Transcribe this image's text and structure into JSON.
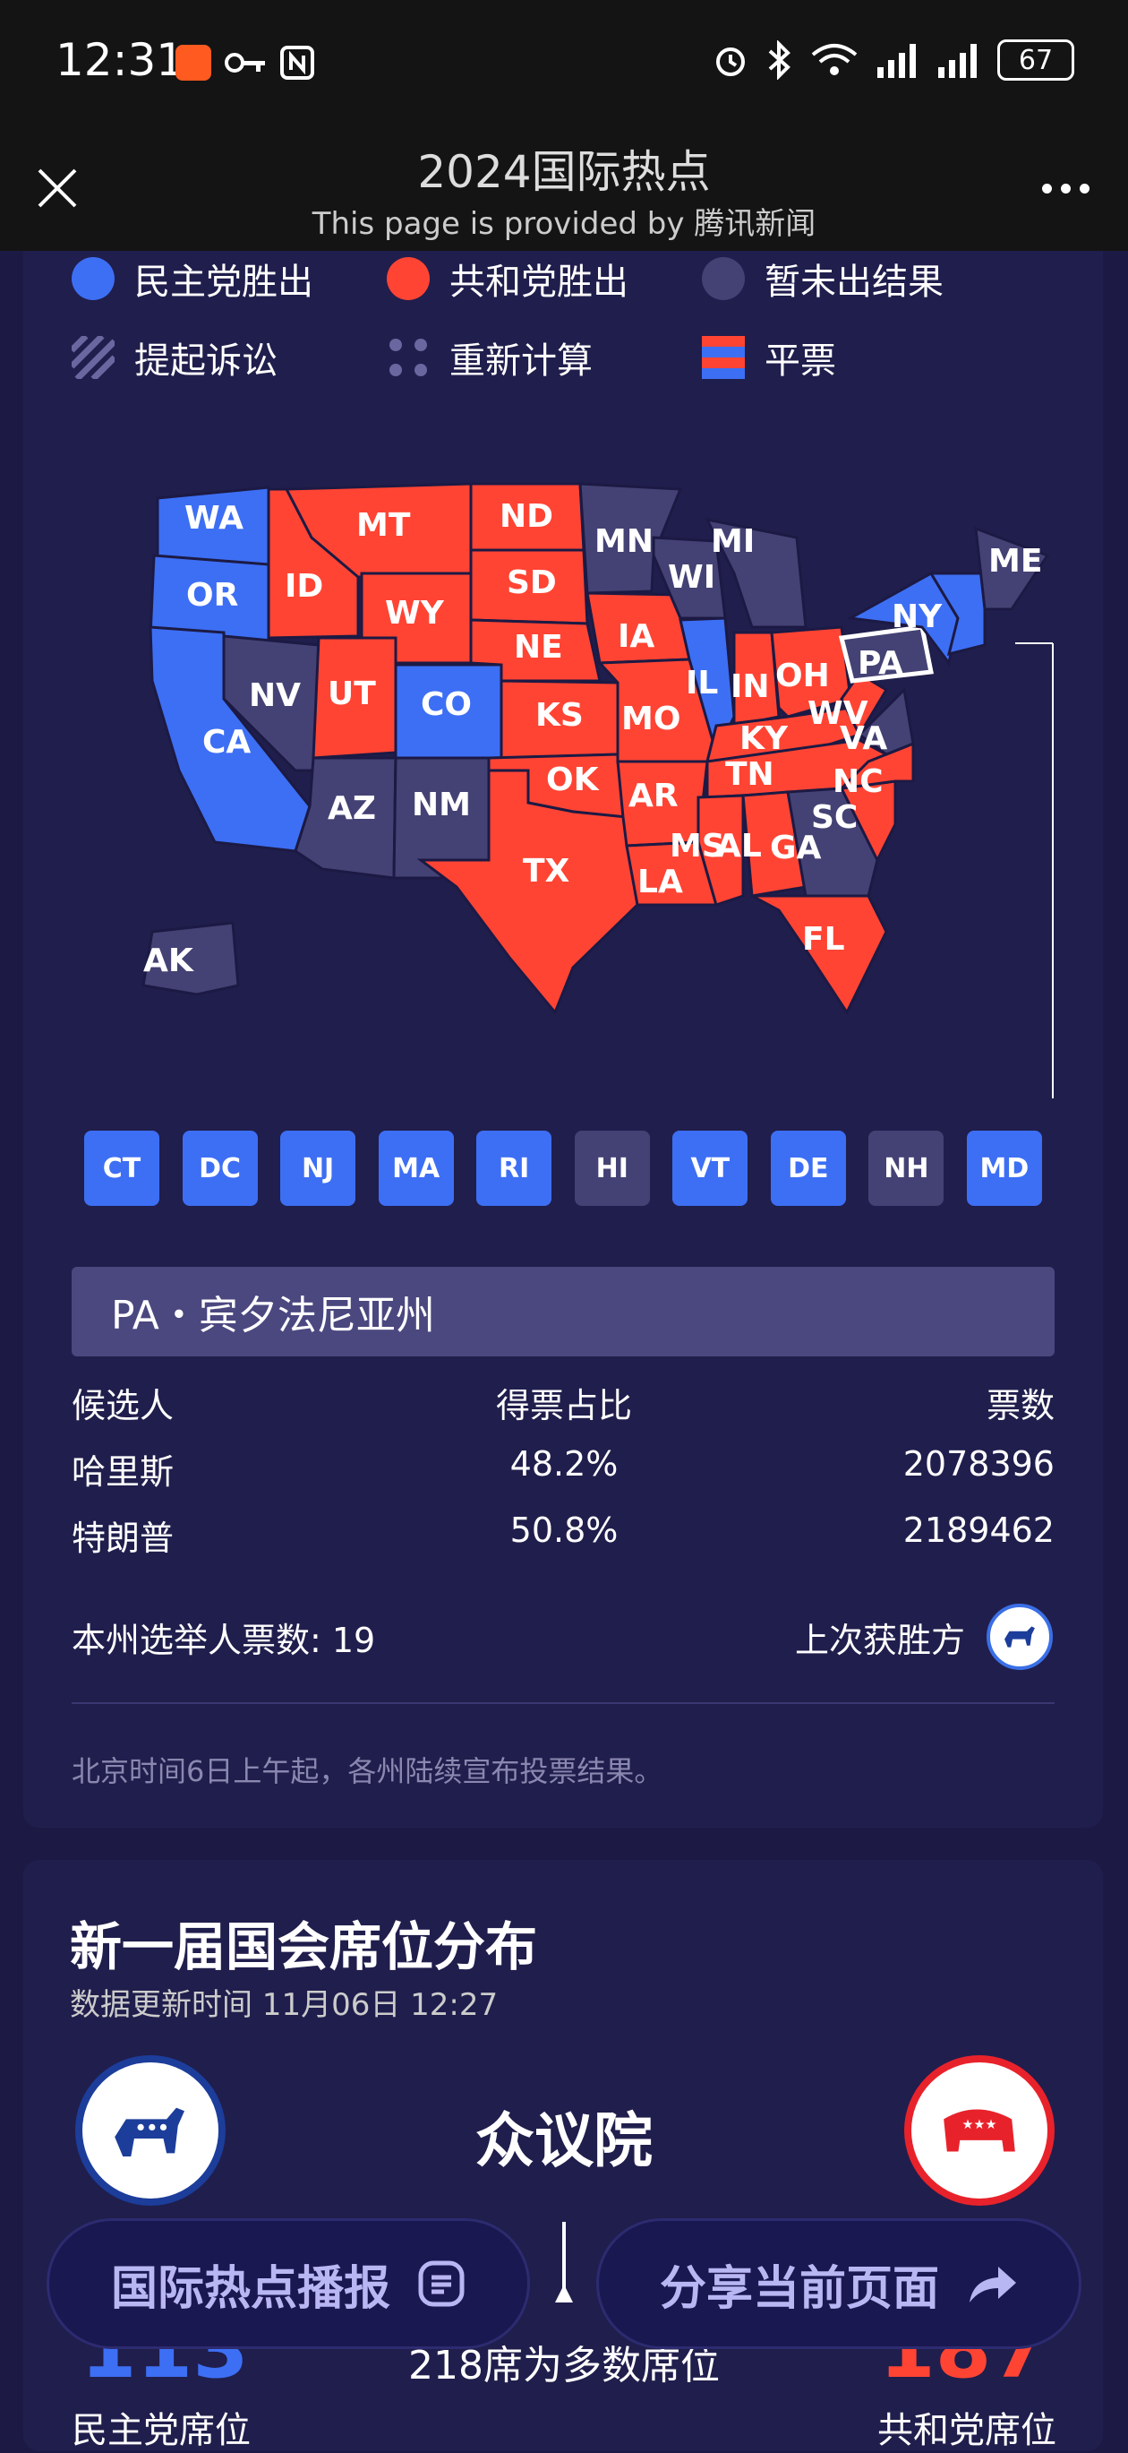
{
  "status_bar": {
    "time": "12:31",
    "battery": "67"
  },
  "title_bar": {
    "title": "2024国际热点",
    "subtitle": "This page is provided by 腾讯新闻"
  },
  "legend": [
    {
      "label": "民主党胜出",
      "color": "#3d6ff4"
    },
    {
      "label": "共和党胜出",
      "color": "#ff4433"
    },
    {
      "label": "暂未出结果",
      "color": "#444274"
    },
    {
      "label": "提起诉讼"
    },
    {
      "label": "重新计算"
    },
    {
      "label": "平票"
    }
  ],
  "map": {
    "states": [
      {
        "abbr": "WA",
        "winner": "dem"
      },
      {
        "abbr": "OR",
        "winner": "dem"
      },
      {
        "abbr": "CA",
        "winner": "dem"
      },
      {
        "abbr": "NV",
        "winner": "pending"
      },
      {
        "abbr": "ID",
        "winner": "rep"
      },
      {
        "abbr": "MT",
        "winner": "rep"
      },
      {
        "abbr": "WY",
        "winner": "rep"
      },
      {
        "abbr": "UT",
        "winner": "rep"
      },
      {
        "abbr": "CO",
        "winner": "dem"
      },
      {
        "abbr": "AZ",
        "winner": "pending"
      },
      {
        "abbr": "NM",
        "winner": "pending"
      },
      {
        "abbr": "ND",
        "winner": "rep"
      },
      {
        "abbr": "SD",
        "winner": "rep"
      },
      {
        "abbr": "NE",
        "winner": "rep"
      },
      {
        "abbr": "KS",
        "winner": "rep"
      },
      {
        "abbr": "OK",
        "winner": "rep"
      },
      {
        "abbr": "TX",
        "winner": "rep"
      },
      {
        "abbr": "MN",
        "winner": "pending"
      },
      {
        "abbr": "IA",
        "winner": "rep"
      },
      {
        "abbr": "MO",
        "winner": "rep"
      },
      {
        "abbr": "AR",
        "winner": "rep"
      },
      {
        "abbr": "LA",
        "winner": "rep"
      },
      {
        "abbr": "WI",
        "winner": "pending"
      },
      {
        "abbr": "IL",
        "winner": "dem"
      },
      {
        "abbr": "MI",
        "winner": "pending"
      },
      {
        "abbr": "IN",
        "winner": "rep"
      },
      {
        "abbr": "OH",
        "winner": "rep"
      },
      {
        "abbr": "KY",
        "winner": "rep"
      },
      {
        "abbr": "TN",
        "winner": "rep"
      },
      {
        "abbr": "MS",
        "winner": "rep"
      },
      {
        "abbr": "AL",
        "winner": "rep"
      },
      {
        "abbr": "GA",
        "winner": "pending"
      },
      {
        "abbr": "FL",
        "winner": "rep"
      },
      {
        "abbr": "SC",
        "winner": "rep"
      },
      {
        "abbr": "NC",
        "winner": "rep"
      },
      {
        "abbr": "VA",
        "winner": "pending"
      },
      {
        "abbr": "WV",
        "winner": "rep"
      },
      {
        "abbr": "PA",
        "winner": "pending"
      },
      {
        "abbr": "NY",
        "winner": "dem"
      },
      {
        "abbr": "ME",
        "winner": "pending"
      },
      {
        "abbr": "AK",
        "winner": "pending"
      }
    ]
  },
  "small_states": [
    {
      "abbr": "CT",
      "winner": "dem"
    },
    {
      "abbr": "DC",
      "winner": "dem"
    },
    {
      "abbr": "NJ",
      "winner": "dem"
    },
    {
      "abbr": "MA",
      "winner": "dem"
    },
    {
      "abbr": "RI",
      "winner": "dem"
    },
    {
      "abbr": "HI",
      "winner": "pending"
    },
    {
      "abbr": "VT",
      "winner": "dem"
    },
    {
      "abbr": "DE",
      "winner": "dem"
    },
    {
      "abbr": "NH",
      "winner": "pending"
    },
    {
      "abbr": "MD",
      "winner": "dem"
    }
  ],
  "selected_state": {
    "title": "PA・宾夕法尼亚州",
    "headers": [
      "候选人",
      "得票占比",
      "票数"
    ],
    "rows": [
      {
        "name": "哈里斯",
        "pct": "48.2%",
        "votes": "2078396"
      },
      {
        "name": "特朗普",
        "pct": "50.8%",
        "votes": "2189462"
      }
    ],
    "electors_label": "本州选举人票数: 19",
    "last_winner_label": "上次获胜方"
  },
  "note": "北京时间6日上午起，各州陆续宣布投票结果。",
  "congress": {
    "title": "新一届国会席位分布",
    "updated": "数据更新时间 11月06日 12:27",
    "chamber": "众议院",
    "majority": "218席为多数席位",
    "dem_label": "民主党席位",
    "rep_label": "共和党席位",
    "dem_seats": "113",
    "rep_seats": "187"
  },
  "bottom_buttons": {
    "broadcast": "国际热点播报",
    "share": "分享当前页面"
  },
  "colors": {
    "dem": "#3d6ff4",
    "rep": "#ff4433",
    "pending": "#444274"
  }
}
